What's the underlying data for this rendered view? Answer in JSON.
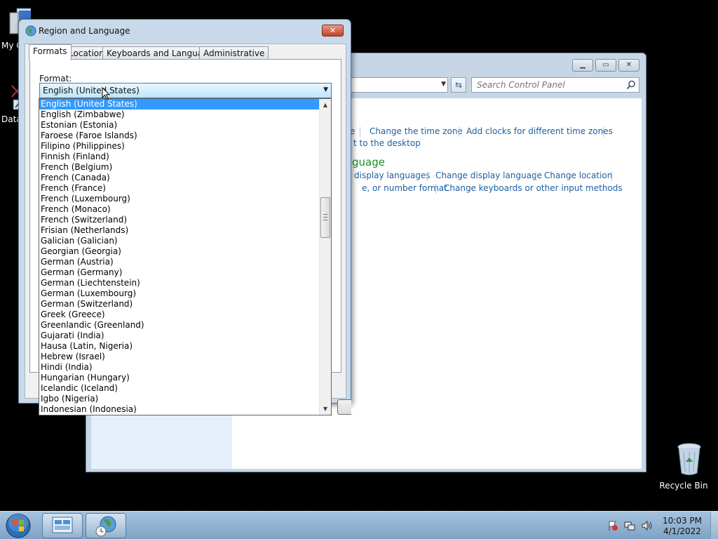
{
  "desktop": {
    "icons": [
      {
        "label": "My C"
      },
      {
        "label": "Data"
      },
      {
        "label": "Recycle Bin"
      }
    ]
  },
  "control_panel": {
    "search_placeholder": "Search Control Panel",
    "links": {
      "fragment_e": "e",
      "change_time_zone": "Change the time zone",
      "add_clocks": "Add clocks for different time zones",
      "fragment_desktop": "t to the desktop",
      "fragment_display_languages": "display languages",
      "change_display_language": "Change display language",
      "change_location": "Change location",
      "fragment_number_format": "e, or number format",
      "change_keyboards": "Change keyboards or other input methods"
    },
    "heading_fragment": "guage"
  },
  "dialog": {
    "title": "Region and Language",
    "close_label": "✕",
    "tabs": [
      "Formats",
      "Location",
      "Keyboards and Languages",
      "Administrative"
    ],
    "format_label": "Format:",
    "format_value": "English (United States)",
    "options": [
      "English (United States)",
      "English (Zimbabwe)",
      "Estonian (Estonia)",
      "Faroese (Faroe Islands)",
      "Filipino (Philippines)",
      "Finnish (Finland)",
      "French (Belgium)",
      "French (Canada)",
      "French (France)",
      "French (Luxembourg)",
      "French (Monaco)",
      "French (Switzerland)",
      "Frisian (Netherlands)",
      "Galician (Galician)",
      "Georgian (Georgia)",
      "German (Austria)",
      "German (Germany)",
      "German (Liechtenstein)",
      "German (Luxembourg)",
      "German (Switzerland)",
      "Greek (Greece)",
      "Greenlandic (Greenland)",
      "Gujarati (India)",
      "Hausa (Latin, Nigeria)",
      "Hebrew (Israel)",
      "Hindi (India)",
      "Hungarian (Hungary)",
      "Icelandic (Iceland)",
      "Igbo (Nigeria)",
      "Indonesian (Indonesia)"
    ],
    "selected_index": 0
  },
  "taskbar": {
    "time": "10:03 PM",
    "date": "4/1/2022"
  },
  "colors": {
    "selection": "#3399ff",
    "link": "#1e5fa0",
    "heading": "#1e8a2a",
    "close_button": "#c4412b"
  }
}
